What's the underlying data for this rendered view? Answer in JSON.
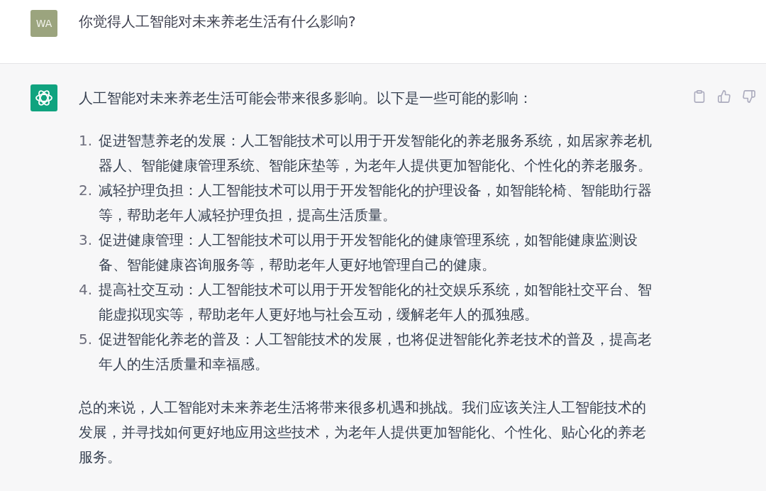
{
  "user_message": {
    "avatar": "WA",
    "text": "你觉得人工智能对未来养老生活有什么影响?"
  },
  "assistant_message": {
    "intro": "人工智能对未来养老生活可能会带来很多影响。以下是一些可能的影响：",
    "list": [
      {
        "marker": "1.",
        "text": "促进智慧养老的发展：人工智能技术可以用于开发智能化的养老服务系统，如居家养老机器人、智能健康管理系统、智能床垫等，为老年人提供更加智能化、个性化的养老服务。"
      },
      {
        "marker": "2.",
        "text": "减轻护理负担：人工智能技术可以用于开发智能化的护理设备，如智能轮椅、智能助行器等，帮助老年人减轻护理负担，提高生活质量。"
      },
      {
        "marker": "3.",
        "text": "促进健康管理：人工智能技术可以用于开发智能化的健康管理系统，如智能健康监测设备、智能健康咨询服务等，帮助老年人更好地管理自己的健康。"
      },
      {
        "marker": "4.",
        "text": "提高社交互动：人工智能技术可以用于开发智能化的社交娱乐系统，如智能社交平台、智能虚拟现实等，帮助老年人更好地与社会互动，缓解老年人的孤独感。"
      },
      {
        "marker": "5.",
        "text": "促进智能化养老的普及：人工智能技术的发展，也将促进智能化养老技术的普及，提高老年人的生活质量和幸福感。"
      }
    ],
    "conclusion": "总的来说，人工智能对未来养老生活将带来很多机遇和挑战。我们应该关注人工智能技术的发展，并寻找如何更好地应用这些技术，为老年人提供更加智能化、个性化、贴心化的养老服务。"
  }
}
